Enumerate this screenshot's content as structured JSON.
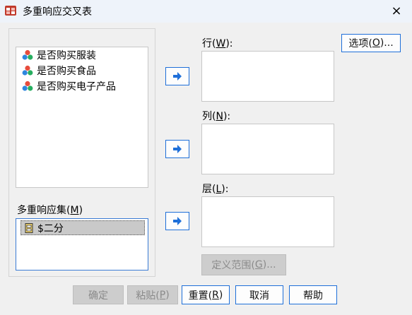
{
  "window": {
    "title": "多重响应交叉表",
    "close_glyph": "×"
  },
  "variables": {
    "items": [
      {
        "label": "是否购买服装",
        "icon": "nominal-variable-icon"
      },
      {
        "label": "是否购买食品",
        "icon": "nominal-variable-icon"
      },
      {
        "label": "是否购买电子产品",
        "icon": "nominal-variable-icon"
      }
    ]
  },
  "mr_sets": {
    "label_text": "多重响应集(",
    "label_key": "M",
    "label_close": ")",
    "items": [
      {
        "label": "$二分",
        "icon": "multiple-response-set-icon"
      }
    ]
  },
  "targets": {
    "row": {
      "text": "行(",
      "key": "W",
      "close": "):"
    },
    "col": {
      "text": "列(",
      "key": "N",
      "close": "):"
    },
    "layer": {
      "text": "层(",
      "key": "L",
      "close": "):"
    }
  },
  "buttons": {
    "options": {
      "text": "选项(",
      "key": "O",
      "close": ")..."
    },
    "define_ranges": {
      "text": "定义范围(",
      "key": "G",
      "close": ")..."
    },
    "ok": {
      "text": "确定"
    },
    "paste": {
      "text": "粘贴(",
      "key": "P",
      "close": ")"
    },
    "reset": {
      "text": "重置(",
      "key": "R",
      "close": ")"
    },
    "cancel": {
      "text": "取消"
    },
    "help": {
      "text": "帮助"
    }
  },
  "colors": {
    "accent": "#1e6fd9",
    "arrow": "#1e6fd9",
    "titlebar": "#eef3fa",
    "dialog": "#f0f0f0"
  }
}
